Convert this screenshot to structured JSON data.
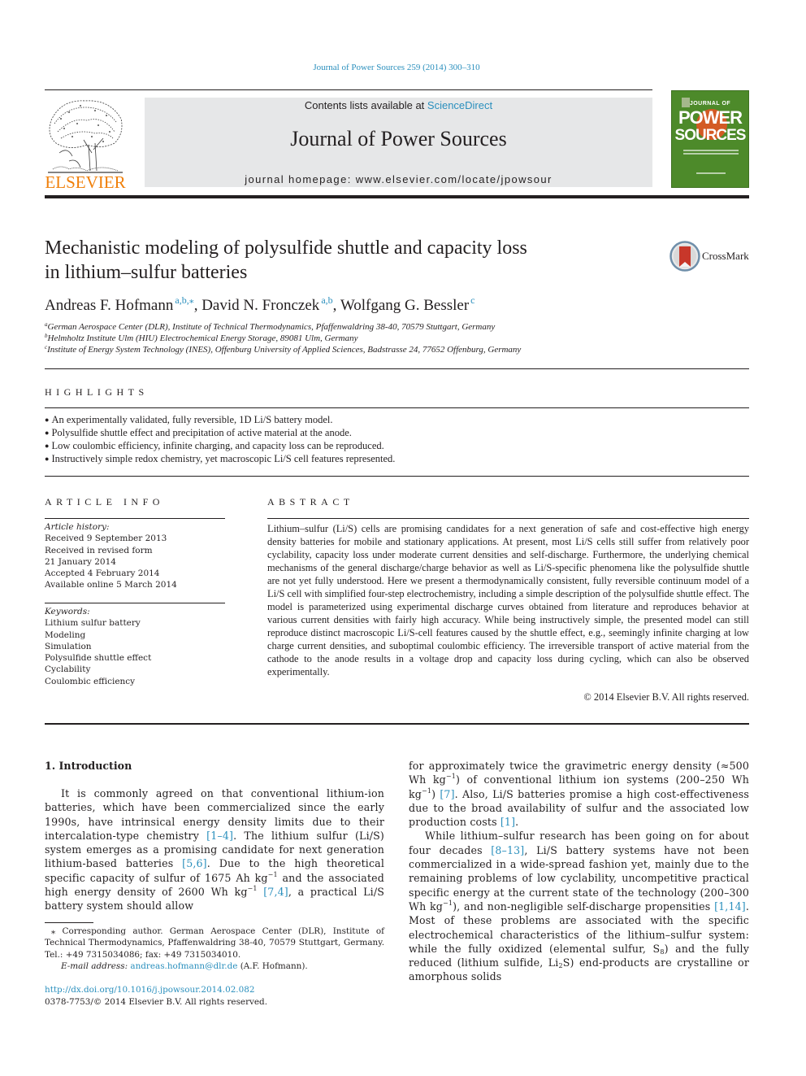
{
  "header": {
    "citation": "Journal of Power Sources 259 (2014) 300–310",
    "contents_prefix": "Contents lists available at ",
    "contents_link": "ScienceDirect",
    "journal_name": "Journal of Power Sources",
    "homepage": "journal homepage: www.elsevier.com/locate/jpowsour",
    "publisher_logo_text": "ELSEVIER",
    "cover": {
      "line1": "JOURNAL OF",
      "line2": "POWER",
      "line3": "SOURCES"
    },
    "crossmark_label": "CrossMark"
  },
  "colors": {
    "link": "#2a8fbd",
    "elsevier_orange": "#f07f09",
    "cover_green": "#4d8a2a",
    "header_box_gray": "#e6e7e8"
  },
  "article": {
    "title_line1": "Mechanistic modeling of polysulfide shuttle and capacity loss",
    "title_line2": "in lithium–sulfur batteries",
    "authors": [
      {
        "name": "Andreas F. Hofmann",
        "sup": "a,b,⁎"
      },
      {
        "name": "David N. Fronczek",
        "sup": "a,b"
      },
      {
        "name": "Wolfgang G. Bessler",
        "sup": "c"
      }
    ],
    "affiliations": [
      {
        "mark": "a",
        "text": "German Aerospace Center (DLR), Institute of Technical Thermodynamics, Pfaffenwaldring 38-40, 70579 Stuttgart, Germany"
      },
      {
        "mark": "b",
        "text": "Helmholtz Institute Ulm (HIU) Electrochemical Energy Storage, 89081 Ulm, Germany"
      },
      {
        "mark": "c",
        "text": "Institute of Energy System Technology (INES), Offenburg University of Applied Sciences, Badstrasse 24, 77652 Offenburg, Germany"
      }
    ]
  },
  "highlights": {
    "heading": "HIGHLIGHTS",
    "items": [
      "An experimentally validated, fully reversible, 1D Li/S battery model.",
      "Polysulfide shuttle effect and precipitation of active material at the anode.",
      "Low coulombic efficiency, infinite charging, and capacity loss can be reproduced.",
      "Instructively simple redox chemistry, yet macroscopic Li/S cell features represented."
    ]
  },
  "article_info": {
    "heading": "ARTICLE INFO",
    "history_label": "Article history:",
    "history": [
      "Received 9 September 2013",
      "Received in revised form",
      "21 January 2014",
      "Accepted 4 February 2014",
      "Available online 5 March 2014"
    ],
    "keywords_label": "Keywords:",
    "keywords": [
      "Lithium sulfur battery",
      "Modeling",
      "Simulation",
      "Polysulfide shuttle effect",
      "Cyclability",
      "Coulombic efficiency"
    ]
  },
  "abstract": {
    "heading": "ABSTRACT",
    "text": "Lithium–sulfur (Li/S) cells are promising candidates for a next generation of safe and cost-effective high energy density batteries for mobile and stationary applications. At present, most Li/S cells still suffer from relatively poor cyclability, capacity loss under moderate current densities and self-discharge. Furthermore, the underlying chemical mechanisms of the general discharge/charge behavior as well as Li/S-specific phenomena like the polysulfide shuttle are not yet fully understood. Here we present a thermodynamically consistent, fully reversible continuum model of a Li/S cell with simplified four-step electrochemistry, including a simple description of the polysulfide shuttle effect. The model is parameterized using experimental discharge curves obtained from literature and reproduces behavior at various current densities with fairly high accuracy. While being instructively simple, the presented model can still reproduce distinct macroscopic Li/S-cell features caused by the shuttle effect, e.g., seemingly infinite charging at low charge current densities, and suboptimal coulombic efficiency. The irreversible transport of active material from the cathode to the anode results in a voltage drop and capacity loss during cycling, which can also be observed experimentally.",
    "copyright": "© 2014 Elsevier B.V. All rights reserved."
  },
  "intro": {
    "heading": "1.  Introduction",
    "left_p1": {
      "t1": "It is commonly agreed on that conventional lithium-ion batteries, which have been commercialized since the early 1990s, have intrinsical energy density limits due to their intercalation-type chemistry ",
      "r1": "[1–4]",
      "t2": ". The lithium sulfur (Li/S) system emerges as a promising candidate for next generation lithium-based batteries ",
      "r2": "[5,6]",
      "t3": ". Due to the high theoretical specific capacity of sulfur of 1675 Ah kg",
      "s1": "−1",
      "t4": " and the associated high energy density of 2600 Wh kg",
      "s2": "−1",
      "t5": " ",
      "r3": "[7,4]",
      "t6": ", a practical Li/S battery system should allow"
    },
    "right_p1": {
      "t1": "for approximately twice the gravimetric energy density (≈500 Wh kg",
      "s1": "−1",
      "t2": ") of conventional lithium ion systems (200–250 Wh kg",
      "s2": "−1",
      "t3": ") ",
      "r1": "[7]",
      "t4": ". Also, Li/S batteries promise a high cost-effectiveness due to the broad availability of sulfur and the associated low production costs ",
      "r2": "[1]",
      "t5": "."
    },
    "right_p2": {
      "t1": "While lithium–sulfur research has been going on for about four decades ",
      "r1": "[8–13]",
      "t2": ", Li/S battery systems have not been commercialized in a wide-spread fashion yet, mainly due to the remaining problems of low cyclability, uncompetitive practical specific energy at the current state of the technology (200–300 Wh kg",
      "s1": "−1",
      "t3": "), and non-negligible self-discharge propensities ",
      "r2": "[1,14]",
      "t4": ". Most of these problems are associated with the specific electrochemical characteristics of the lithium–sulfur system: while the fully oxidized (elemental sulfur, S",
      "sub1": "8",
      "t5": ") and the fully reduced (lithium sulfide, Li",
      "sub2": "2",
      "t6": "S) end-products are crystalline or amorphous solids"
    }
  },
  "footnote": {
    "star": "⁎",
    "text": " Corresponding author. German Aerospace Center (DLR), Institute of Technical Thermodynamics, Pfaffenwaldring 38-40, 70579 Stuttgart, Germany. Tel.: +49 7315034086; fax: +49 7315034010.",
    "email_label": "E-mail address: ",
    "email": "andreas.hofmann@dlr.de",
    "email_suffix": " (A.F. Hofmann).",
    "doi": "http://dx.doi.org/10.1016/j.jpowsour.2014.02.082",
    "issn": "0378-7753/© 2014 Elsevier B.V. All rights reserved."
  }
}
